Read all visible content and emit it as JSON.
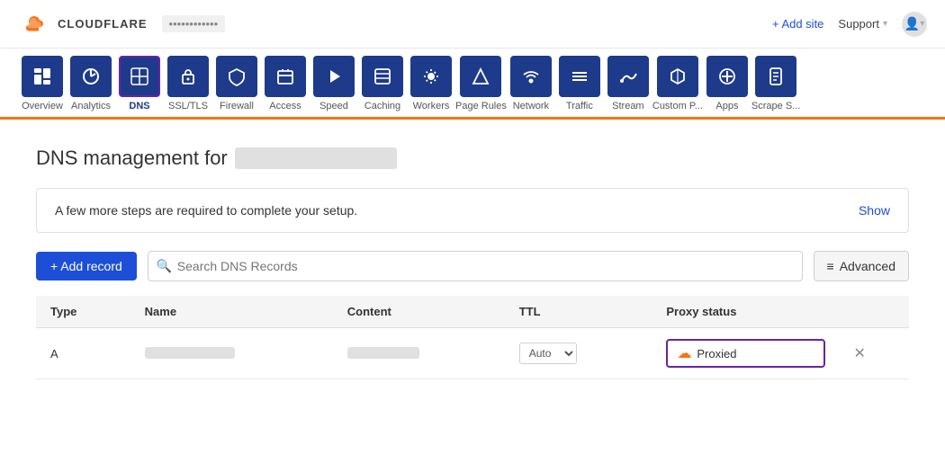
{
  "header": {
    "logo_text": "CLOUDFLARE",
    "domain": "••••••••••••",
    "add_site": "+ Add site",
    "support": "Support",
    "account_icon": "👤"
  },
  "nav": {
    "items": [
      {
        "id": "overview",
        "label": "Overview",
        "icon": "☰",
        "active": false
      },
      {
        "id": "analytics",
        "label": "Analytics",
        "icon": "◉",
        "active": false
      },
      {
        "id": "dns",
        "label": "DNS",
        "icon": "⊞",
        "active": true
      },
      {
        "id": "ssl-tls",
        "label": "SSL/TLS",
        "icon": "🔒",
        "active": false
      },
      {
        "id": "firewall",
        "label": "Firewall",
        "icon": "🛡",
        "active": false
      },
      {
        "id": "access",
        "label": "Access",
        "icon": "📋",
        "active": false
      },
      {
        "id": "speed",
        "label": "Speed",
        "icon": "⚡",
        "active": false
      },
      {
        "id": "caching",
        "label": "Caching",
        "icon": "▤",
        "active": false
      },
      {
        "id": "workers",
        "label": "Workers",
        "icon": "◈",
        "active": false
      },
      {
        "id": "page-rules",
        "label": "Page Rules",
        "icon": "⊽",
        "active": false
      },
      {
        "id": "network",
        "label": "Network",
        "icon": "📍",
        "active": false
      },
      {
        "id": "traffic",
        "label": "Traffic",
        "icon": "≡",
        "active": false
      },
      {
        "id": "stream",
        "label": "Stream",
        "icon": "☁",
        "active": false
      },
      {
        "id": "custom-pages",
        "label": "Custom P...",
        "icon": "🔧",
        "active": false
      },
      {
        "id": "apps",
        "label": "Apps",
        "icon": "✚",
        "active": false
      },
      {
        "id": "scrape-shield",
        "label": "Scrape S...",
        "icon": "📄",
        "active": false
      }
    ]
  },
  "main": {
    "title": "DNS management for",
    "domain_placeholder": "•••••••••••••••",
    "setup_notice": "A few more steps are required to complete your setup.",
    "show_label": "Show",
    "add_record_label": "+ Add record",
    "search_placeholder": "Search DNS Records",
    "advanced_label": "Advanced",
    "table": {
      "headers": [
        "Type",
        "Name",
        "Content",
        "TTL",
        "Proxy status"
      ],
      "rows": [
        {
          "type": "A",
          "name": "••••••••••••",
          "content": "••• ••• ••",
          "ttl": "Auto",
          "proxy_status": "Proxied"
        }
      ]
    }
  }
}
